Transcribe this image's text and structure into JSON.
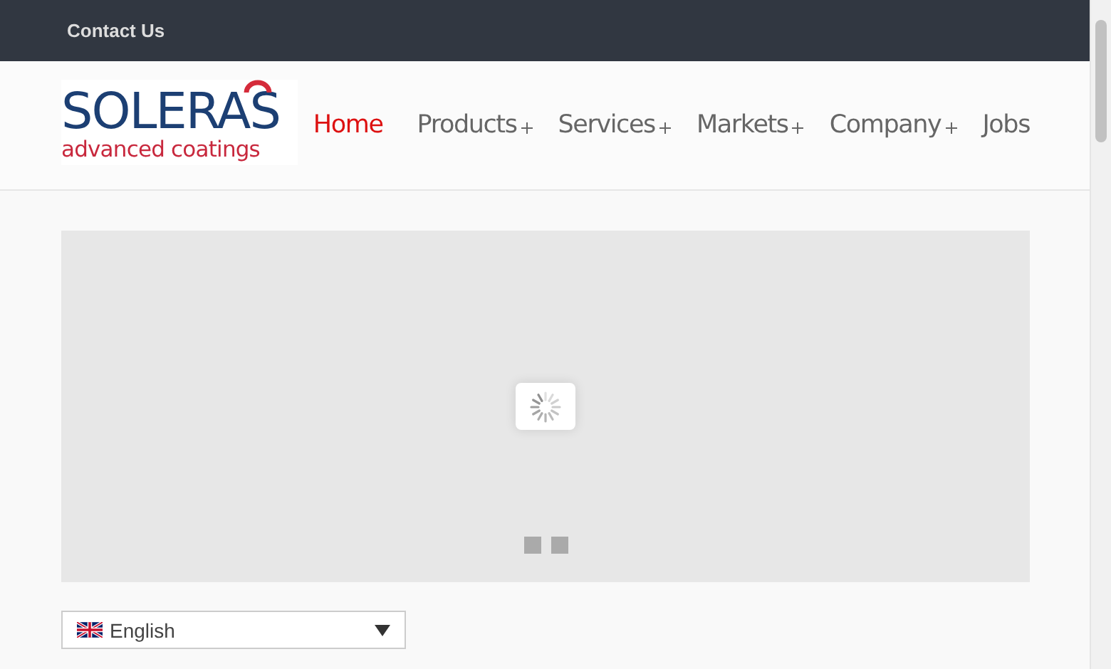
{
  "top_bar": {
    "links": [
      "Contact Us"
    ]
  },
  "logo": {
    "name": "SOLERAS",
    "tagline": "advanced coatings"
  },
  "nav": [
    {
      "label": "Home",
      "selected": true,
      "has_submenu": false
    },
    {
      "label": "Products",
      "selected": false,
      "has_submenu": true
    },
    {
      "label": "Services",
      "selected": false,
      "has_submenu": true
    },
    {
      "label": "Markets",
      "selected": false,
      "has_submenu": true
    },
    {
      "label": "Company",
      "selected": false,
      "has_submenu": true
    },
    {
      "label": "Jobs",
      "selected": false,
      "has_submenu": false
    }
  ],
  "slider": {
    "loading": true,
    "dots": [
      {
        "selected": false
      },
      {
        "selected": false
      }
    ]
  },
  "language_select": {
    "value": "English"
  }
}
